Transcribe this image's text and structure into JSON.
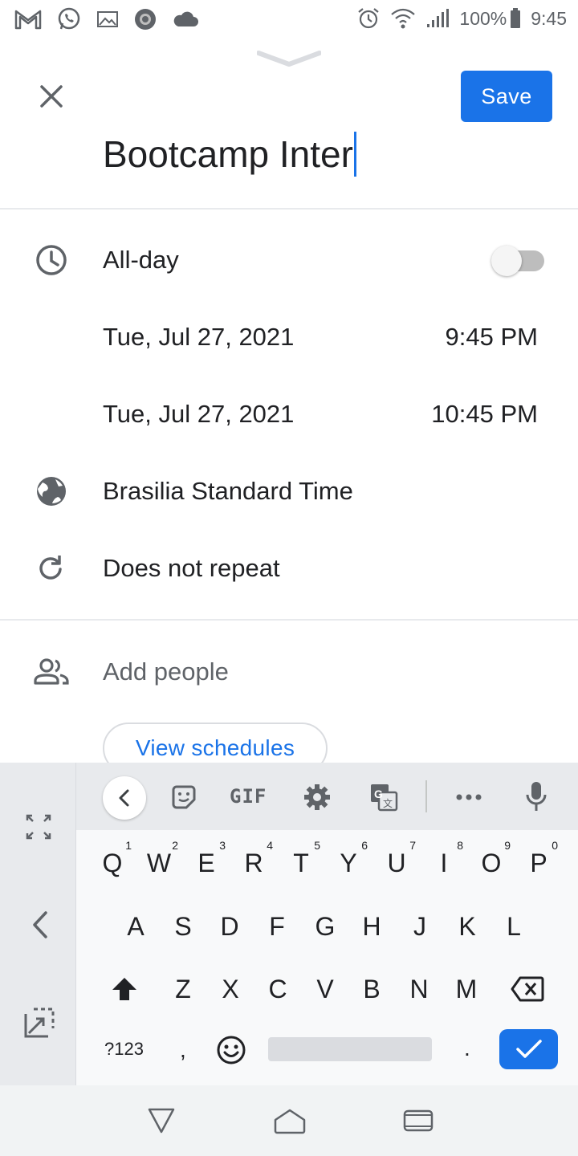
{
  "status_bar": {
    "icons_left": [
      "gmail-icon",
      "whatsapp-icon",
      "image-icon",
      "record-icon",
      "cloud-icon"
    ],
    "icons_right": [
      "alarm-icon",
      "wifi-icon",
      "signal-icon"
    ],
    "battery": "100%",
    "time": "9:45"
  },
  "header": {
    "close_icon": "close-icon",
    "save_label": "Save",
    "title_value": "Bootcamp Inter"
  },
  "event": {
    "all_day_label": "All-day",
    "all_day_enabled": false,
    "start_date": "Tue, Jul 27, 2021",
    "start_time": "9:45 PM",
    "end_date": "Tue, Jul 27, 2021",
    "end_time": "10:45 PM",
    "timezone": "Brasilia Standard Time",
    "repeat": "Does not repeat",
    "add_people_placeholder": "Add people",
    "view_schedules_label": "View schedules"
  },
  "keyboard": {
    "toolbar": [
      "back-icon",
      "sticker-icon",
      "GIF",
      "settings-icon",
      "translate-icon",
      "more-icon",
      "mic-icon"
    ],
    "gif_label": "GIF",
    "row1": [
      {
        "key": "Q",
        "hint": "1"
      },
      {
        "key": "W",
        "hint": "2"
      },
      {
        "key": "E",
        "hint": "3"
      },
      {
        "key": "R",
        "hint": "4"
      },
      {
        "key": "T",
        "hint": "5"
      },
      {
        "key": "Y",
        "hint": "6"
      },
      {
        "key": "U",
        "hint": "7"
      },
      {
        "key": "I",
        "hint": "8"
      },
      {
        "key": "O",
        "hint": "9"
      },
      {
        "key": "P",
        "hint": "0"
      }
    ],
    "row2": [
      "A",
      "S",
      "D",
      "F",
      "G",
      "H",
      "J",
      "K",
      "L"
    ],
    "row3": [
      "Z",
      "X",
      "C",
      "V",
      "B",
      "N",
      "M"
    ],
    "symbols_label": "?123",
    "comma": ",",
    "period": "."
  },
  "colors": {
    "accent": "#1a73e8",
    "text": "#202124",
    "muted": "#5f6368",
    "divider": "#e8eaed"
  }
}
